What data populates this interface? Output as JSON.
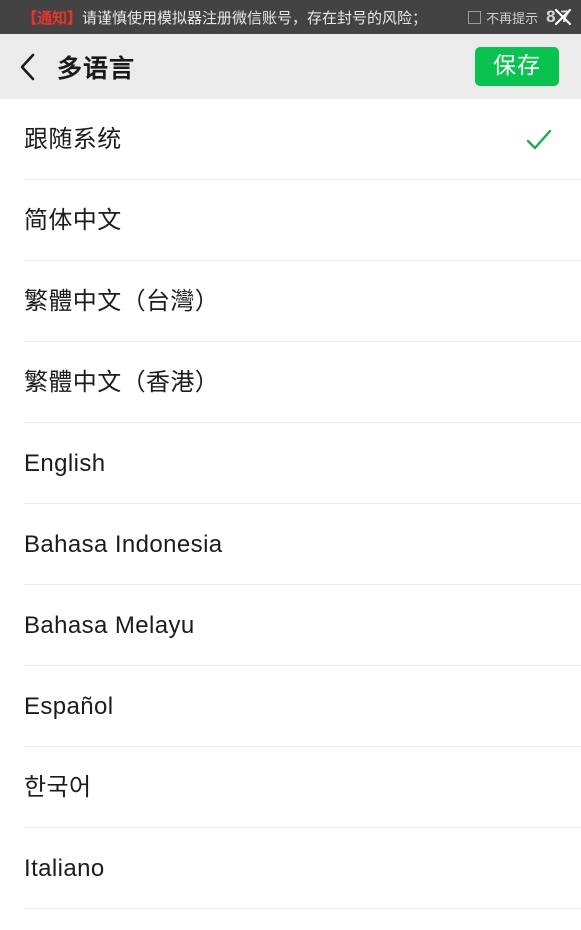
{
  "notice": {
    "tag": "【通知】",
    "message": "请谨慎使用模拟器注册微信账号，存在封号的风险；",
    "checkbox_label": "不再提示",
    "counter": "87",
    "close_icon": "close-icon",
    "checkbox_icon": "checkbox-unchecked-icon",
    "bar_color": "#434343",
    "tag_color": "#e8352c"
  },
  "header": {
    "back_icon": "chevron-left-icon",
    "title": "多语言",
    "save_label": "保存",
    "save_color": "#0ac250",
    "background": "#ebebeb"
  },
  "list": {
    "check_icon": "check-icon",
    "check_color": "#1aad4b",
    "items": [
      {
        "label": "跟随系统",
        "selected": true
      },
      {
        "label": "简体中文",
        "selected": false
      },
      {
        "label": "繁體中文（台灣）",
        "selected": false
      },
      {
        "label": "繁體中文（香港）",
        "selected": false
      },
      {
        "label": "English",
        "selected": false
      },
      {
        "label": "Bahasa Indonesia",
        "selected": false
      },
      {
        "label": "Bahasa Melayu",
        "selected": false
      },
      {
        "label": "Español",
        "selected": false
      },
      {
        "label": "한국어",
        "selected": false
      },
      {
        "label": "Italiano",
        "selected": false
      }
    ]
  }
}
